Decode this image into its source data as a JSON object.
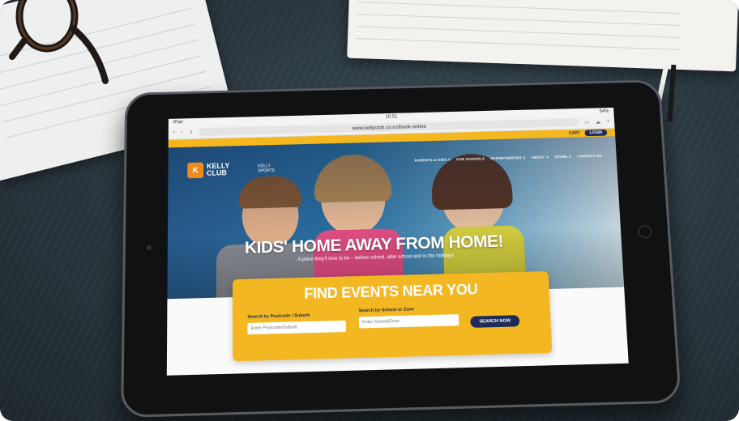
{
  "scene": {
    "description_colors": {
      "slate": "#2b3840",
      "brand_orange": "#f08a1f",
      "brand_yellow": "#f3b722",
      "brand_navy": "#1d2a5a"
    }
  },
  "ipad": {
    "status": {
      "carrier": "iPad",
      "time": "10:51",
      "battery": "54%"
    },
    "browser": {
      "url": "www.kellyclub.co.nz/book-online"
    },
    "site": {
      "topbar": {
        "cart": "CART",
        "login": "LOGIN"
      },
      "logo": {
        "mark": "K",
        "line1": "KELLY",
        "line2": "CLUB"
      },
      "logo2": {
        "line1": "KELLY",
        "line2": "SPORTS"
      },
      "nav": [
        "PARENTS & KIDS ∨",
        "FOR SCHOOLS",
        "OPPORTUNITIES ∨",
        "ABOUT ∨",
        "STORE ∨",
        "CONTACT US"
      ],
      "hero": {
        "headline": "KIDS' HOME AWAY FROM HOME!",
        "subline": "A place they'll love to be – before school, after school and in the holidays"
      },
      "finder": {
        "title": "FIND EVENTS NEAR YOU",
        "postcode_label": "Search by Postcode / Suburb",
        "postcode_placeholder": "Enter Postcode/Suburb",
        "school_label": "Search by School or Zone",
        "school_placeholder": "Enter School/Zone",
        "search_button": "SEARCH NOW"
      }
    }
  }
}
